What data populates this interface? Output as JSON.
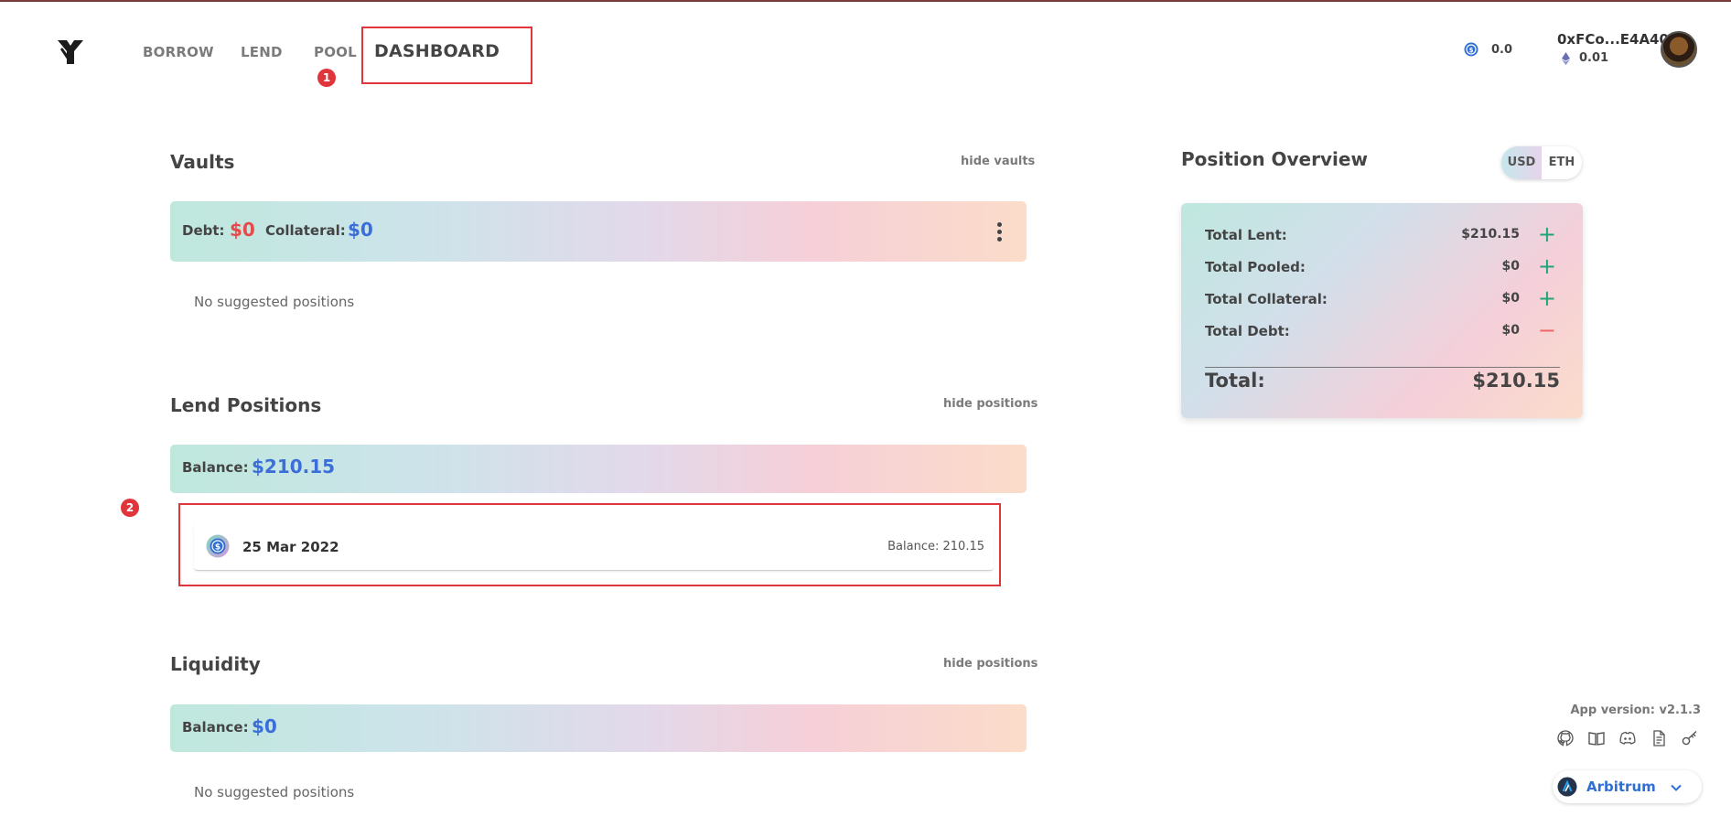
{
  "nav": {
    "borrow": "BORROW",
    "lend": "LEND",
    "pool": "POOL",
    "dashboard": "DASHBOARD"
  },
  "annotations": {
    "one": "1",
    "two": "2"
  },
  "wallet": {
    "token_balance": "0.0",
    "address": "0xFCo...E4A40",
    "eth_balance": "0.01"
  },
  "vaults": {
    "title": "Vaults",
    "hide": "hide vaults",
    "debt_label": "Debt:",
    "debt_value": "$0",
    "collateral_label": "Collateral:",
    "collateral_value": "$0",
    "empty": "No suggested positions"
  },
  "lend": {
    "title": "Lend Positions",
    "hide": "hide positions",
    "balance_label": "Balance:",
    "balance_value": "$210.15",
    "positions": [
      {
        "date": "25 Mar 2022",
        "balance_label": "Balance:",
        "balance_value": "210.15"
      }
    ]
  },
  "liquidity": {
    "title": "Liquidity",
    "hide": "hide positions",
    "balance_label": "Balance:",
    "balance_value": "$0",
    "empty": "No suggested positions"
  },
  "overview": {
    "title": "Position Overview",
    "toggle": {
      "usd": "USD",
      "eth": "ETH",
      "selected": "USD"
    },
    "rows": [
      {
        "label": "Total Lent:",
        "value": "$210.15",
        "action": "+"
      },
      {
        "label": "Total Pooled:",
        "value": "$0",
        "action": "+"
      },
      {
        "label": "Total Collateral:",
        "value": "$0",
        "action": "+"
      },
      {
        "label": "Total Debt:",
        "value": "$0",
        "action": "−"
      }
    ],
    "total_label": "Total:",
    "total_value": "$210.15"
  },
  "footer": {
    "version": "App version: v2.1.3",
    "icons": [
      "github-icon",
      "book-icon",
      "discord-icon",
      "document-icon",
      "key-icon"
    ],
    "network": "Arbitrum"
  },
  "colors": {
    "debt_red": "#e84a4a",
    "value_blue": "#3b6ed8",
    "plus_green": "#1fa67a",
    "annotation_red": "#e0353a"
  }
}
